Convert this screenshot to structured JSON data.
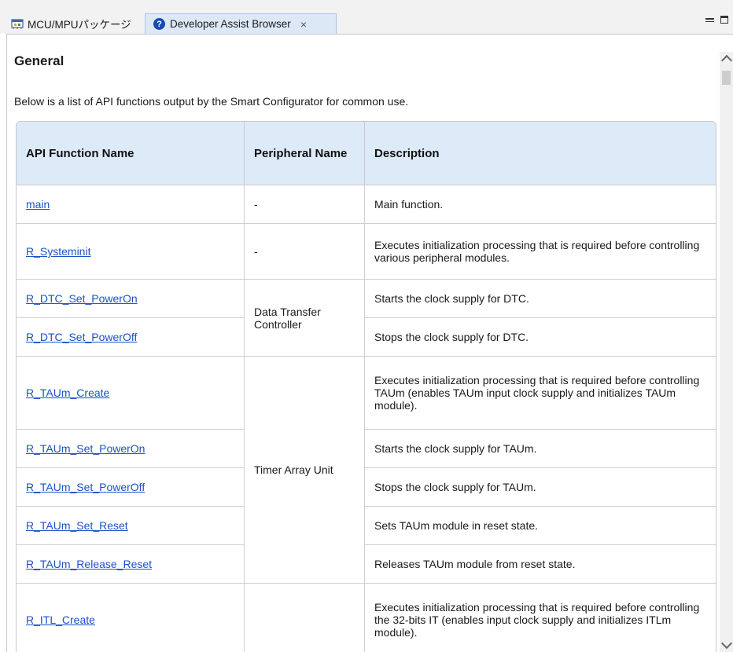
{
  "tabs": [
    {
      "label": "MCU/MPUパッケージ",
      "icon": "package-icon"
    },
    {
      "label": "Developer Assist Browser",
      "icon": "help-icon",
      "close": "×",
      "active": true
    }
  ],
  "page": {
    "title": "General",
    "intro": "Below is a list of API functions output by the Smart Configurator for common use."
  },
  "table": {
    "headers": [
      "API Function Name",
      "Peripheral Name",
      "Description"
    ],
    "groups": [
      {
        "peripheral": "-",
        "rows": [
          {
            "fn": "main",
            "desc": "Main function."
          }
        ]
      },
      {
        "peripheral": "-",
        "rows": [
          {
            "fn": "R_Systeminit",
            "desc": "Executes initialization processing that is required before controlling various peripheral modules."
          }
        ]
      },
      {
        "peripheral": "Data Transfer Controller",
        "rows": [
          {
            "fn": "R_DTC_Set_PowerOn",
            "desc": "Starts the clock supply for DTC."
          },
          {
            "fn": "R_DTC_Set_PowerOff",
            "desc": "Stops the clock supply for DTC."
          }
        ]
      },
      {
        "peripheral": "Timer Array Unit",
        "rows": [
          {
            "fn": "R_TAUm_Create",
            "desc": "Executes initialization processing that is required before controlling TAUm (enables TAUm input clock supply and initializes TAUm module)."
          },
          {
            "fn": "R_TAUm_Set_PowerOn",
            "desc": "Starts the clock supply for TAUm."
          },
          {
            "fn": "R_TAUm_Set_PowerOff",
            "desc": "Stops the clock supply for TAUm."
          },
          {
            "fn": "R_TAUm_Set_Reset",
            "desc": "Sets TAUm module in reset state."
          },
          {
            "fn": "R_TAUm_Release_Reset",
            "desc": "Releases TAUm module from reset state."
          }
        ]
      },
      {
        "peripheral": "",
        "rows": [
          {
            "fn": "R_ITL_Create",
            "desc": "Executes initialization processing that is required before controlling the 32-bits IT (enables input clock supply and initializes ITLm module)."
          }
        ]
      }
    ]
  },
  "colors": {
    "link": "#1a52c7",
    "header_bg": "#ddeaf8",
    "active_tab": "#dde8f7"
  }
}
